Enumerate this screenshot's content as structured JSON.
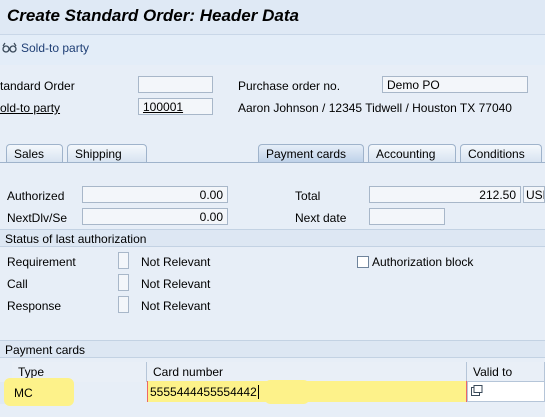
{
  "title": "Create Standard Order: Header Data",
  "toolbar": {
    "sold_to_party_label": "Sold-to party"
  },
  "header": {
    "standard_order_label": "tandard Order",
    "standard_order_value": "",
    "sold_to_label": "old-to party",
    "sold_to_value": "100001",
    "po_label": "Purchase order no.",
    "po_value": "Demo PO",
    "sold_to_desc": "Aaron Johnson / 12345 Tidwell / Houston TX 77040"
  },
  "tabs": [
    {
      "label": "Sales"
    },
    {
      "label": "Shipping"
    },
    {
      "label": "Payment cards"
    },
    {
      "label": "Accounting"
    },
    {
      "label": "Conditions"
    }
  ],
  "payment": {
    "authorized_label": "Authorized",
    "authorized_value": "0.00",
    "nextdlv_label": "NextDlv/Se",
    "nextdlv_value": "0.00",
    "total_label": "Total",
    "total_value": "212.50",
    "currency": "USD",
    "next_date_label": "Next date",
    "next_date_value": ""
  },
  "status": {
    "header": "Status of last authorization",
    "rows": [
      {
        "label": "Requirement",
        "value": "Not Relevant"
      },
      {
        "label": "Call",
        "value": "Not Relevant"
      },
      {
        "label": "Response",
        "value": "Not Relevant"
      }
    ],
    "auth_block_label": "Authorization block"
  },
  "cards": {
    "header": "Payment cards",
    "columns": [
      "Type",
      "Card number",
      "Valid to"
    ],
    "rows": [
      {
        "type": "MC",
        "number": "5555444455554442",
        "valid_to": ""
      }
    ]
  },
  "colors": {
    "highlight": "#fdf28a",
    "background": "#dfe9f5"
  }
}
